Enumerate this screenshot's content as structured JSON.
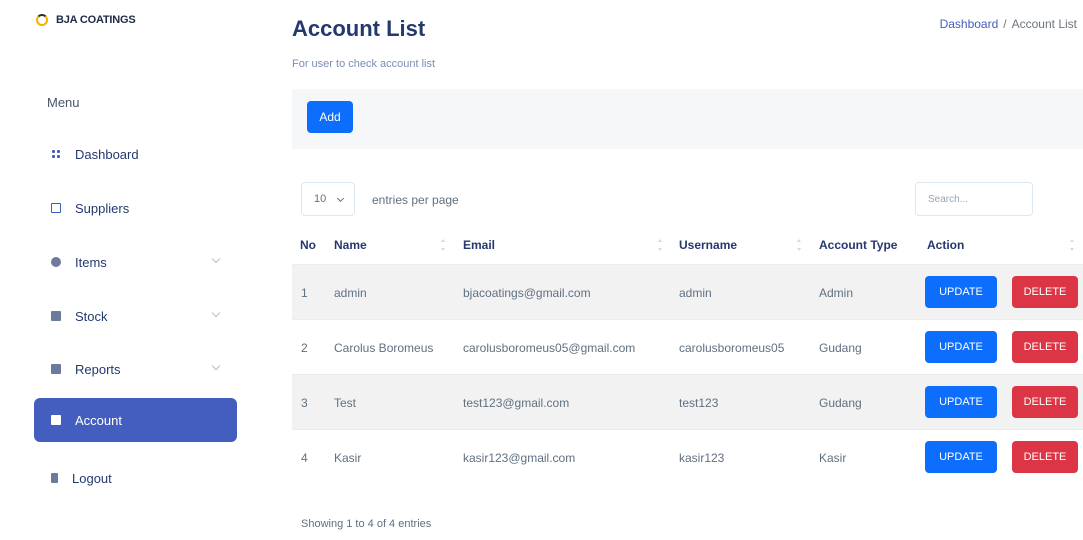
{
  "brand": {
    "name": "BJA COATINGS"
  },
  "sidebar": {
    "menu_title": "Menu",
    "items": [
      {
        "label": "Dashboard",
        "icon": "grid-icon"
      },
      {
        "label": "Suppliers",
        "icon": "monitor-icon"
      },
      {
        "label": "Items",
        "icon": "box-icon",
        "has_submenu": true
      },
      {
        "label": "Stock",
        "icon": "stack-icon",
        "has_submenu": true
      },
      {
        "label": "Reports",
        "icon": "file-icon",
        "has_submenu": true
      },
      {
        "label": "Account",
        "icon": "account-icon",
        "active": true
      },
      {
        "label": "Logout",
        "icon": "door-icon"
      }
    ]
  },
  "header": {
    "title": "Account List",
    "subtitle": "For user to check account list",
    "breadcrumb": {
      "link": "Dashboard",
      "separator": "/",
      "current": "Account List"
    }
  },
  "toolbar": {
    "add_label": "Add"
  },
  "table_controls": {
    "per_page_value": "10",
    "per_page_label": "entries per page",
    "search_placeholder": "Search..."
  },
  "table": {
    "columns": [
      "No",
      "Name",
      "Email",
      "Username",
      "Account Type",
      "Action"
    ],
    "rows": [
      {
        "no": "1",
        "name": "admin",
        "email": "bjacoatings@gmail.com",
        "username": "admin",
        "type": "Admin"
      },
      {
        "no": "2",
        "name": "Carolus Boromeus",
        "email": "carolusboromeus05@gmail.com",
        "username": "carolusboromeus05",
        "type": "Gudang"
      },
      {
        "no": "3",
        "name": "Test",
        "email": "test123@gmail.com",
        "username": "test123",
        "type": "Gudang"
      },
      {
        "no": "4",
        "name": "Kasir",
        "email": "kasir123@gmail.com",
        "username": "kasir123",
        "type": "Kasir"
      }
    ],
    "update_label": "UPDATE",
    "delete_label": "DELETE",
    "info": "Showing 1 to 4 of 4 entries"
  },
  "colors": {
    "accent": "#435ebe",
    "primary_button": "#0d6efd",
    "danger_button": "#dc3545"
  }
}
